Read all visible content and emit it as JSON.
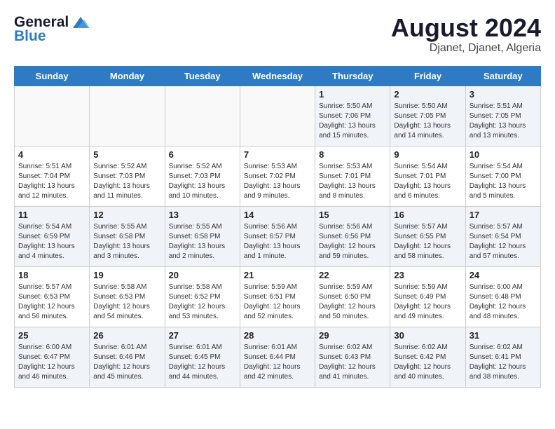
{
  "header": {
    "logo_general": "General",
    "logo_blue": "Blue",
    "month": "August 2024",
    "location": "Djanet, Djanet, Algeria"
  },
  "weekdays": [
    "Sunday",
    "Monday",
    "Tuesday",
    "Wednesday",
    "Thursday",
    "Friday",
    "Saturday"
  ],
  "weeks": [
    [
      {
        "day": "",
        "content": ""
      },
      {
        "day": "",
        "content": ""
      },
      {
        "day": "",
        "content": ""
      },
      {
        "day": "",
        "content": ""
      },
      {
        "day": "1",
        "content": "Sunrise: 5:50 AM\nSunset: 7:06 PM\nDaylight: 13 hours\nand 15 minutes."
      },
      {
        "day": "2",
        "content": "Sunrise: 5:50 AM\nSunset: 7:05 PM\nDaylight: 13 hours\nand 14 minutes."
      },
      {
        "day": "3",
        "content": "Sunrise: 5:51 AM\nSunset: 7:05 PM\nDaylight: 13 hours\nand 13 minutes."
      }
    ],
    [
      {
        "day": "4",
        "content": "Sunrise: 5:51 AM\nSunset: 7:04 PM\nDaylight: 13 hours\nand 12 minutes."
      },
      {
        "day": "5",
        "content": "Sunrise: 5:52 AM\nSunset: 7:03 PM\nDaylight: 13 hours\nand 11 minutes."
      },
      {
        "day": "6",
        "content": "Sunrise: 5:52 AM\nSunset: 7:03 PM\nDaylight: 13 hours\nand 10 minutes."
      },
      {
        "day": "7",
        "content": "Sunrise: 5:53 AM\nSunset: 7:02 PM\nDaylight: 13 hours\nand 9 minutes."
      },
      {
        "day": "8",
        "content": "Sunrise: 5:53 AM\nSunset: 7:01 PM\nDaylight: 13 hours\nand 8 minutes."
      },
      {
        "day": "9",
        "content": "Sunrise: 5:54 AM\nSunset: 7:01 PM\nDaylight: 13 hours\nand 6 minutes."
      },
      {
        "day": "10",
        "content": "Sunrise: 5:54 AM\nSunset: 7:00 PM\nDaylight: 13 hours\nand 5 minutes."
      }
    ],
    [
      {
        "day": "11",
        "content": "Sunrise: 5:54 AM\nSunset: 6:59 PM\nDaylight: 13 hours\nand 4 minutes."
      },
      {
        "day": "12",
        "content": "Sunrise: 5:55 AM\nSunset: 6:58 PM\nDaylight: 13 hours\nand 3 minutes."
      },
      {
        "day": "13",
        "content": "Sunrise: 5:55 AM\nSunset: 6:58 PM\nDaylight: 13 hours\nand 2 minutes."
      },
      {
        "day": "14",
        "content": "Sunrise: 5:56 AM\nSunset: 6:57 PM\nDaylight: 13 hours\nand 1 minute."
      },
      {
        "day": "15",
        "content": "Sunrise: 5:56 AM\nSunset: 6:56 PM\nDaylight: 12 hours\nand 59 minutes."
      },
      {
        "day": "16",
        "content": "Sunrise: 5:57 AM\nSunset: 6:55 PM\nDaylight: 12 hours\nand 58 minutes."
      },
      {
        "day": "17",
        "content": "Sunrise: 5:57 AM\nSunset: 6:54 PM\nDaylight: 12 hours\nand 57 minutes."
      }
    ],
    [
      {
        "day": "18",
        "content": "Sunrise: 5:57 AM\nSunset: 6:53 PM\nDaylight: 12 hours\nand 56 minutes."
      },
      {
        "day": "19",
        "content": "Sunrise: 5:58 AM\nSunset: 6:53 PM\nDaylight: 12 hours\nand 54 minutes."
      },
      {
        "day": "20",
        "content": "Sunrise: 5:58 AM\nSunset: 6:52 PM\nDaylight: 12 hours\nand 53 minutes."
      },
      {
        "day": "21",
        "content": "Sunrise: 5:59 AM\nSunset: 6:51 PM\nDaylight: 12 hours\nand 52 minutes."
      },
      {
        "day": "22",
        "content": "Sunrise: 5:59 AM\nSunset: 6:50 PM\nDaylight: 12 hours\nand 50 minutes."
      },
      {
        "day": "23",
        "content": "Sunrise: 5:59 AM\nSunset: 6:49 PM\nDaylight: 12 hours\nand 49 minutes."
      },
      {
        "day": "24",
        "content": "Sunrise: 6:00 AM\nSunset: 6:48 PM\nDaylight: 12 hours\nand 48 minutes."
      }
    ],
    [
      {
        "day": "25",
        "content": "Sunrise: 6:00 AM\nSunset: 6:47 PM\nDaylight: 12 hours\nand 46 minutes."
      },
      {
        "day": "26",
        "content": "Sunrise: 6:01 AM\nSunset: 6:46 PM\nDaylight: 12 hours\nand 45 minutes."
      },
      {
        "day": "27",
        "content": "Sunrise: 6:01 AM\nSunset: 6:45 PM\nDaylight: 12 hours\nand 44 minutes."
      },
      {
        "day": "28",
        "content": "Sunrise: 6:01 AM\nSunset: 6:44 PM\nDaylight: 12 hours\nand 42 minutes."
      },
      {
        "day": "29",
        "content": "Sunrise: 6:02 AM\nSunset: 6:43 PM\nDaylight: 12 hours\nand 41 minutes."
      },
      {
        "day": "30",
        "content": "Sunrise: 6:02 AM\nSunset: 6:42 PM\nDaylight: 12 hours\nand 40 minutes."
      },
      {
        "day": "31",
        "content": "Sunrise: 6:02 AM\nSunset: 6:41 PM\nDaylight: 12 hours\nand 38 minutes."
      }
    ]
  ]
}
